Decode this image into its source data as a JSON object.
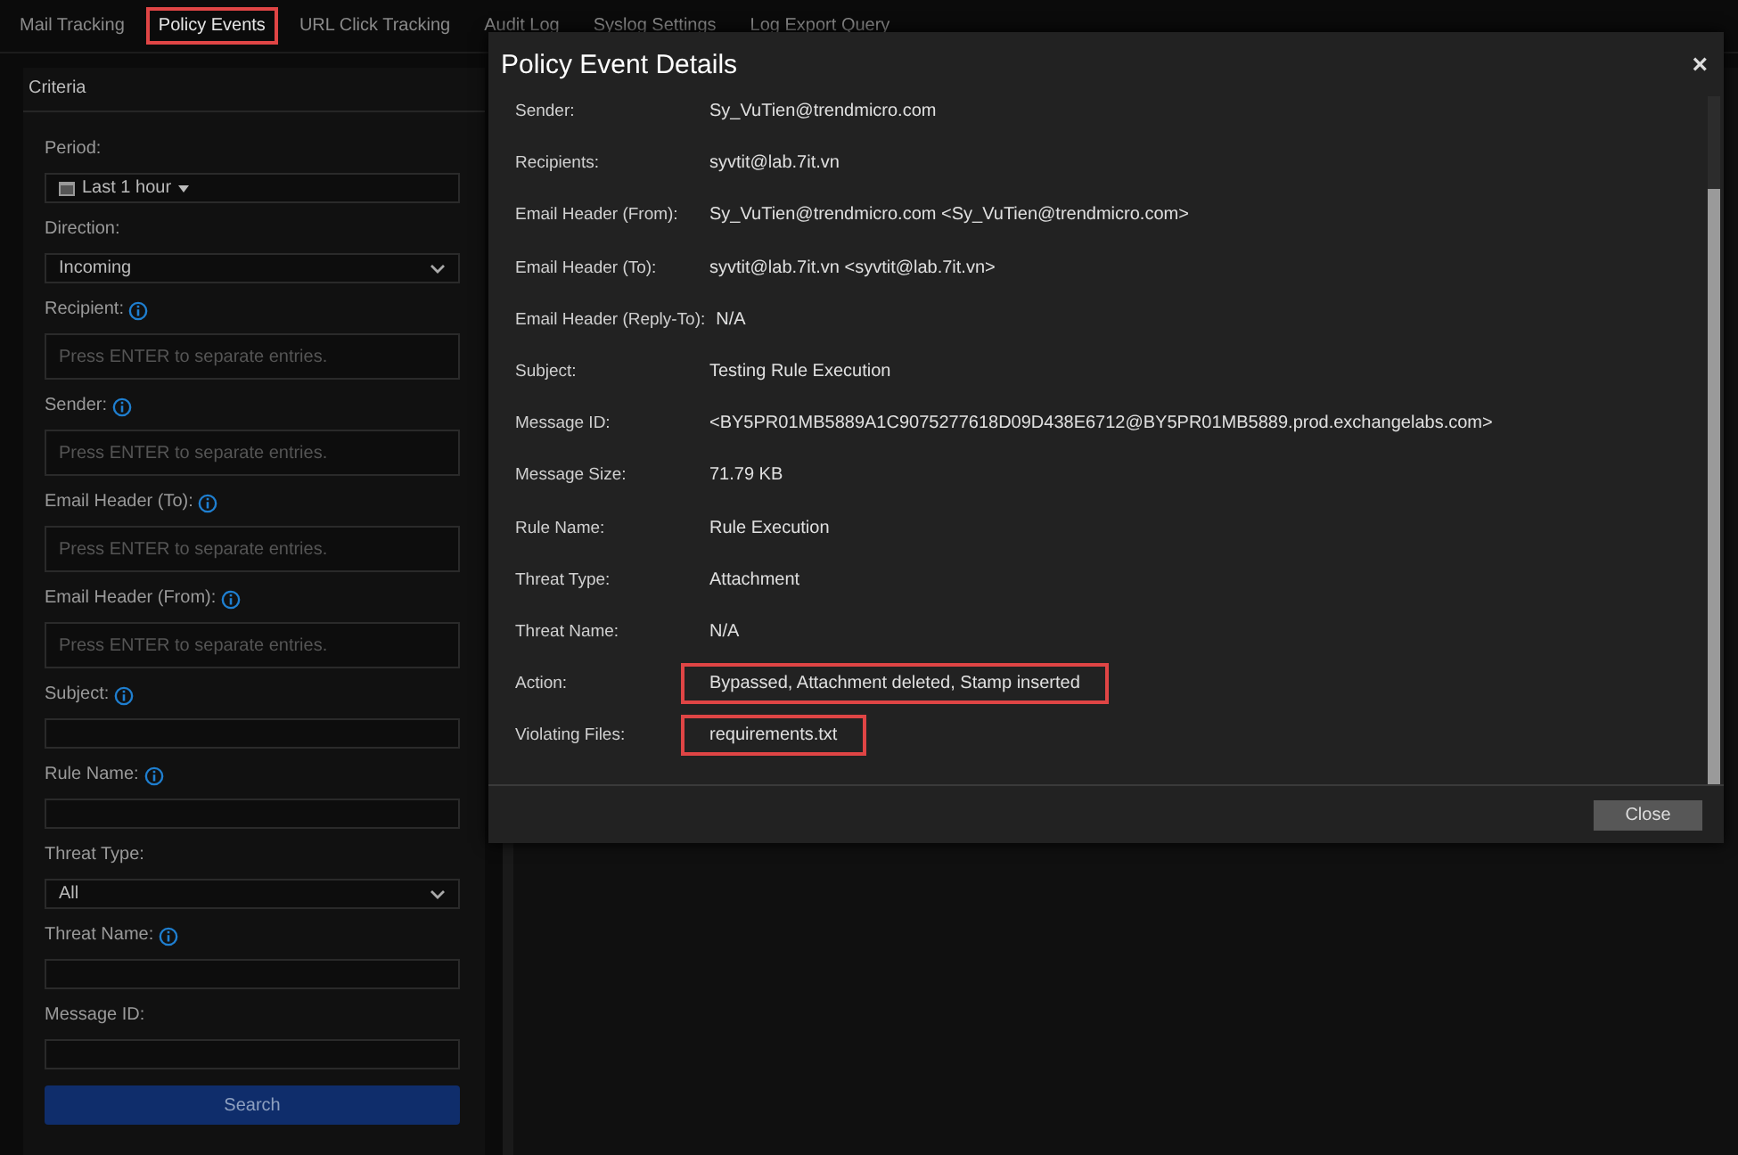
{
  "tabs": [
    {
      "label": "Mail Tracking",
      "selected": false,
      "highlighted": false
    },
    {
      "label": "Policy Events",
      "selected": true,
      "highlighted": true
    },
    {
      "label": "URL Click Tracking",
      "selected": false,
      "highlighted": false
    },
    {
      "label": "Audit Log",
      "selected": false,
      "highlighted": false
    },
    {
      "label": "Syslog Settings",
      "selected": false,
      "highlighted": false
    },
    {
      "label": "Log Export Query",
      "selected": false,
      "highlighted": false
    }
  ],
  "criteria": {
    "title": "Criteria",
    "fields": [
      {
        "kind": "date",
        "label": "Period:",
        "info": false,
        "value": "Last 1 hour"
      },
      {
        "kind": "select",
        "label": "Direction:",
        "info": false,
        "value": "Incoming"
      },
      {
        "kind": "entries",
        "label": "Recipient:",
        "info": true,
        "placeholder": "Press ENTER to separate entries."
      },
      {
        "kind": "entries",
        "label": "Sender:",
        "info": true,
        "placeholder": "Press ENTER to separate entries."
      },
      {
        "kind": "entries",
        "label": "Email Header (To):",
        "info": true,
        "placeholder": "Press ENTER to separate entries."
      },
      {
        "kind": "entries",
        "label": "Email Header (From):",
        "info": true,
        "placeholder": "Press ENTER to separate entries."
      },
      {
        "kind": "text",
        "label": "Subject:",
        "info": true
      },
      {
        "kind": "text",
        "label": "Rule Name:",
        "info": true
      },
      {
        "kind": "select",
        "label": "Threat Type:",
        "info": false,
        "value": "All"
      },
      {
        "kind": "text",
        "label": "Threat Name:",
        "info": true
      },
      {
        "kind": "text",
        "label": "Message ID:",
        "info": false
      }
    ],
    "button": "Search"
  },
  "dialog": {
    "title": "Policy Event Details",
    "close_icon": "×",
    "rows": [
      {
        "label": "Sender:",
        "value": "Sy_VuTien@trendmicro.com",
        "highlighted": false
      },
      {
        "label": "Recipients:",
        "value": "syvtit@lab.7it.vn",
        "highlighted": false
      },
      {
        "label": "Email Header (From):",
        "value": "Sy_VuTien@trendmicro.com <Sy_VuTien@trendmicro.com>",
        "highlighted": false
      },
      {
        "label": "Email Header (To):",
        "value": "syvtit@lab.7it.vn <syvtit@lab.7it.vn>",
        "highlighted": false
      },
      {
        "label": "Email Header (Reply-To):",
        "value": "N/A",
        "highlighted": false
      },
      {
        "label": "Subject:",
        "value": "Testing Rule Execution",
        "highlighted": false
      },
      {
        "label": "Message ID:",
        "value": "<BY5PR01MB5889A1C9075277618D09D438E6712@BY5PR01MB5889.prod.exchangelabs.com>",
        "highlighted": false
      },
      {
        "label": "Message Size:",
        "value": "71.79 KB",
        "highlighted": false
      },
      {
        "label": "Rule Name:",
        "value": "Rule Execution",
        "highlighted": false
      },
      {
        "label": "Threat Type:",
        "value": "Attachment",
        "highlighted": false
      },
      {
        "label": "Threat Name:",
        "value": "N/A",
        "highlighted": false
      },
      {
        "label": "Action:",
        "value": "Bypassed, Attachment deleted, Stamp inserted",
        "highlighted": true
      },
      {
        "label": "Violating Files:",
        "value": "requirements.txt",
        "highlighted": true
      }
    ],
    "button": "Close"
  }
}
